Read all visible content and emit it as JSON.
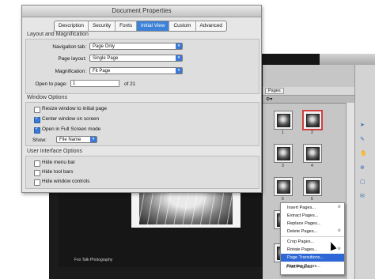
{
  "dialog": {
    "title": "Document Properties",
    "tabs": [
      {
        "label": "Description"
      },
      {
        "label": "Security"
      },
      {
        "label": "Fonts"
      },
      {
        "label": "Initial View"
      },
      {
        "label": "Custom"
      },
      {
        "label": "Advanced"
      }
    ],
    "active_tab": "Initial View",
    "layout": {
      "section_title": "Layout and Magnification",
      "nav_tab_label": "Navigation tab:",
      "nav_tab_value": "Page Only",
      "page_layout_label": "Page layout:",
      "page_layout_value": "Single Page",
      "magnification_label": "Magnification:",
      "magnification_value": "Fit Page",
      "open_to_page_label": "Open to page:",
      "open_to_page_value": "1",
      "page_count": "of 21"
    },
    "window_options": {
      "section_title": "Window Options",
      "resize_label": "Resize window to initial page",
      "resize_checked": false,
      "center_label": "Center window on screen",
      "center_checked": true,
      "fullscreen_label": "Open in Full Screen mode",
      "fullscreen_checked": true,
      "show_label": "Show:",
      "show_value": "File Name"
    },
    "ui_options": {
      "section_title": "User Interface Options",
      "hide_menu_label": "Hide menu bar",
      "hide_menu_checked": false,
      "hide_tool_label": "Hide tool bars",
      "hide_tool_checked": false,
      "hide_window_label": "Hide window controls",
      "hide_window_checked": false
    }
  },
  "pages_panel": {
    "tab_label": "Pages",
    "thumb_numbers": [
      "1",
      "2",
      "3",
      "4",
      "5",
      "6",
      "7",
      "8"
    ]
  },
  "document": {
    "footer_text": "Fox Talk Photography"
  },
  "context_menu": {
    "items": [
      {
        "label": "Insert Pages..."
      },
      {
        "label": "Extract Pages..."
      },
      {
        "label": "Replace Pages..."
      },
      {
        "label": "Delete Pages..."
      },
      {
        "label": "Crop Pages..."
      },
      {
        "label": "Rotate Pages..."
      },
      {
        "label": "Page Transitions..."
      },
      {
        "label": "Number Pages..."
      },
      {
        "label": "Print Pages..."
      }
    ],
    "highlighted": "Page Transitions..."
  },
  "colors": {
    "accent": "#3d82d8",
    "menu_highlight": "#2f67d6",
    "selected_thumb_border": "#d04040"
  }
}
